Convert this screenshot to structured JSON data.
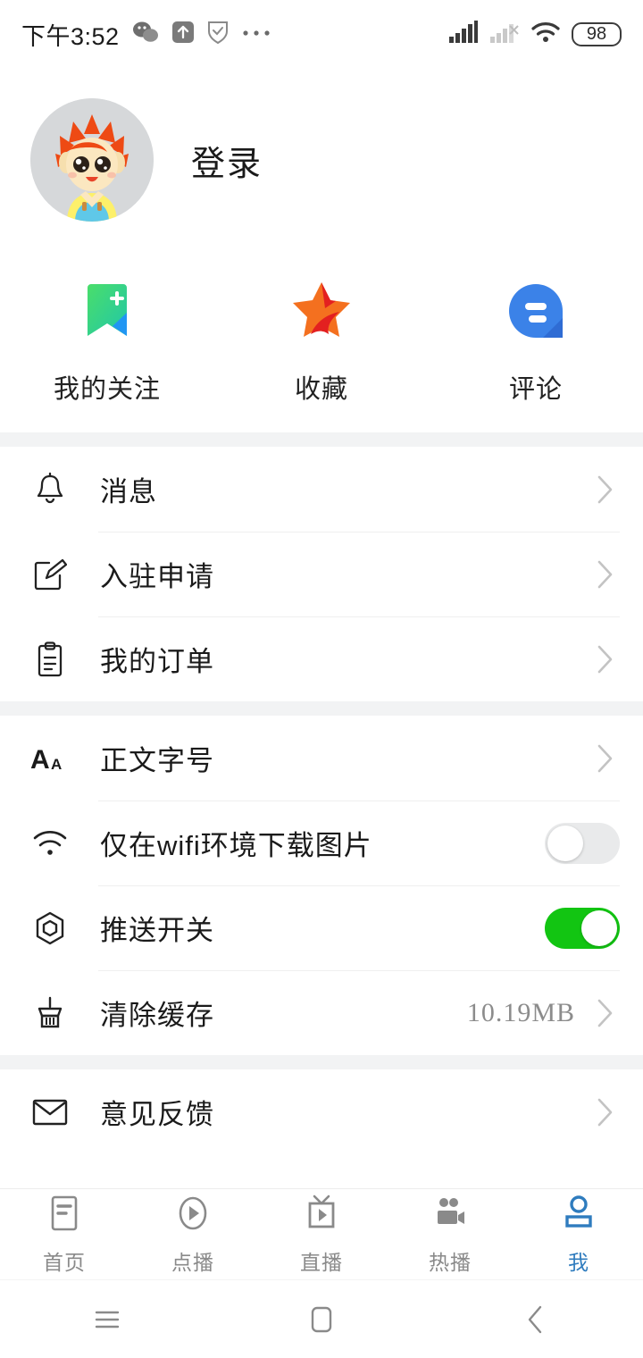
{
  "status_bar": {
    "time": "下午3:52",
    "battery_level": "98",
    "left_icons": [
      "wechat-icon",
      "upload-arrow-icon",
      "shield-icon",
      "more-dots-icon"
    ],
    "right_icons": [
      "signal-bars-icon",
      "signal-bars-off-icon",
      "wifi-icon",
      "battery-icon"
    ]
  },
  "profile": {
    "avatar_name": "cartoon-hedgehog-avatar",
    "login_text": "登录"
  },
  "quick_actions": [
    {
      "label": "我的关注",
      "icon": "bookmark-plus-icon"
    },
    {
      "label": "收藏",
      "icon": "star-icon"
    },
    {
      "label": "评论",
      "icon": "comment-bubble-icon"
    }
  ],
  "groups": [
    {
      "rows": [
        {
          "label": "消息",
          "icon": "bell-icon",
          "type": "chevron"
        },
        {
          "label": "入驻申请",
          "icon": "edit-square-icon",
          "type": "chevron"
        },
        {
          "label": "我的订单",
          "icon": "clipboard-icon",
          "type": "chevron"
        }
      ]
    },
    {
      "rows": [
        {
          "label": "正文字号",
          "icon": "font-size-icon",
          "type": "chevron"
        },
        {
          "label": "仅在wifi环境下载图片",
          "icon": "wifi-icon",
          "type": "toggle",
          "toggle_on": false
        },
        {
          "label": "推送开关",
          "icon": "push-hexagon-icon",
          "type": "toggle",
          "toggle_on": true
        },
        {
          "label": "清除缓存",
          "icon": "broom-icon",
          "type": "value-chevron",
          "value": "10.19MB"
        }
      ]
    },
    {
      "rows": [
        {
          "label": "意见反馈",
          "icon": "envelope-icon",
          "type": "chevron"
        }
      ]
    }
  ],
  "tabs": [
    {
      "label": "首页",
      "icon": "news-page-icon",
      "active": false
    },
    {
      "label": "点播",
      "icon": "circle-play-icon",
      "active": false
    },
    {
      "label": "直播",
      "icon": "tv-icon",
      "active": false
    },
    {
      "label": "热播",
      "icon": "video-camera-icon",
      "active": false
    },
    {
      "label": "我",
      "icon": "person-icon",
      "active": true
    }
  ],
  "android_nav": [
    {
      "icon": "recents-menu-icon"
    },
    {
      "icon": "home-square-icon"
    },
    {
      "icon": "back-chevron-icon"
    }
  ],
  "colors": {
    "accent_blue": "#2f7cbe",
    "toggle_on_green": "#12c512",
    "toggle_off_gray": "#e9eaeb",
    "chevron_gray": "#c3c3c3",
    "separator": "#f2f3f4"
  }
}
